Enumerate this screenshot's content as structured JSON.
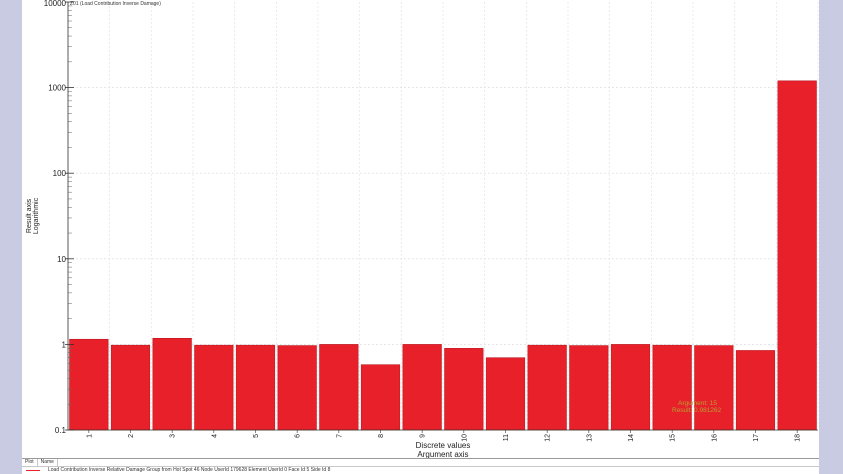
{
  "chart_data": {
    "type": "bar",
    "series_title": "Z01 (Load Contribution Inverse Damage)",
    "y_scale": "log",
    "ylim": [
      0.1,
      10000
    ],
    "y_ticks": [
      "0.1",
      "1",
      "10",
      "100",
      "1000",
      "10000"
    ],
    "ylabel": "Result axis",
    "ylabel2": "Logarithmic",
    "xlabel": "Discrete values",
    "xlabel2": "Argument axis",
    "categories": [
      "1",
      "2",
      "3",
      "4",
      "5",
      "6",
      "7",
      "8",
      "9",
      "10",
      "11",
      "12",
      "13",
      "14",
      "15",
      "16",
      "17",
      "18"
    ],
    "values": [
      1.15,
      0.98,
      1.18,
      0.98,
      0.98,
      0.97,
      1.0,
      0.58,
      1.0,
      0.9,
      0.7,
      0.98,
      0.97,
      1.0,
      0.98,
      0.97,
      0.85,
      1200
    ],
    "bar_color": "#e8202a",
    "grid": true,
    "annotation": {
      "line1": "Argument: 15",
      "line2": "Result: 0.981262",
      "color": "#b8a030"
    }
  },
  "legend": {
    "col_plot": "Plot",
    "col_name": "Name",
    "entry": "Load Contribution Inverse Relative Damage Group from Hot Spot 46 Node UserId 179628 Element UserId 0 Face Id 5 Side Id 8"
  }
}
